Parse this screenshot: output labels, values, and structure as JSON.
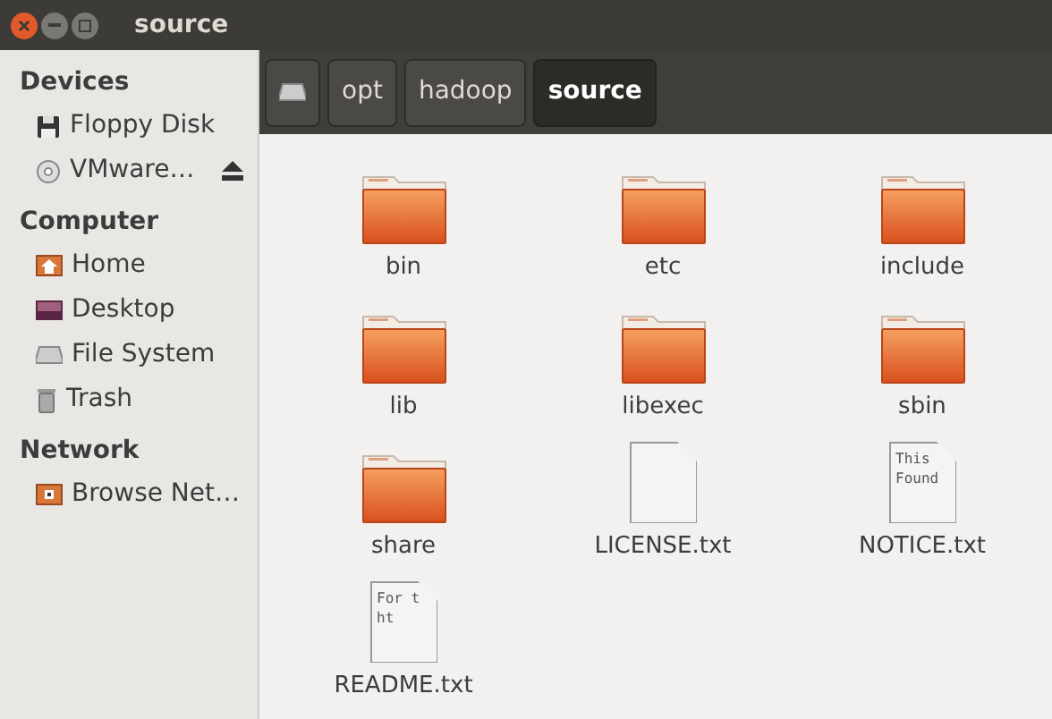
{
  "window": {
    "title": "source"
  },
  "sidebar": {
    "sections": [
      {
        "title": "Devices",
        "items": [
          {
            "label": "Floppy Disk",
            "kind": "floppy"
          },
          {
            "label": "VMware…",
            "kind": "disc",
            "eject": true
          }
        ]
      },
      {
        "title": "Computer",
        "items": [
          {
            "label": "Home",
            "kind": "home"
          },
          {
            "label": "Desktop",
            "kind": "desktop"
          },
          {
            "label": "File System",
            "kind": "drive"
          },
          {
            "label": "Trash",
            "kind": "trash"
          }
        ]
      },
      {
        "title": "Network",
        "items": [
          {
            "label": "Browse Net…",
            "kind": "network"
          }
        ]
      }
    ]
  },
  "breadcrumbs": [
    {
      "kind": "drive",
      "selected": false
    },
    {
      "kind": "text",
      "label": "opt",
      "selected": false
    },
    {
      "kind": "text",
      "label": "hadoop",
      "selected": false
    },
    {
      "kind": "text",
      "label": "source",
      "selected": true
    }
  ],
  "files": [
    {
      "kind": "folder",
      "name": "bin"
    },
    {
      "kind": "folder",
      "name": "etc"
    },
    {
      "kind": "folder",
      "name": "include"
    },
    {
      "kind": "folder",
      "name": "lib"
    },
    {
      "kind": "folder",
      "name": "libexec"
    },
    {
      "kind": "folder",
      "name": "sbin"
    },
    {
      "kind": "folder",
      "name": "share"
    },
    {
      "kind": "text",
      "name": "LICENSE.txt"
    },
    {
      "kind": "text",
      "name": "NOTICE.txt",
      "preview": [
        "This",
        "Found"
      ]
    },
    {
      "kind": "text",
      "name": "README.txt",
      "preview": [
        "For t",
        "ht"
      ]
    }
  ]
}
